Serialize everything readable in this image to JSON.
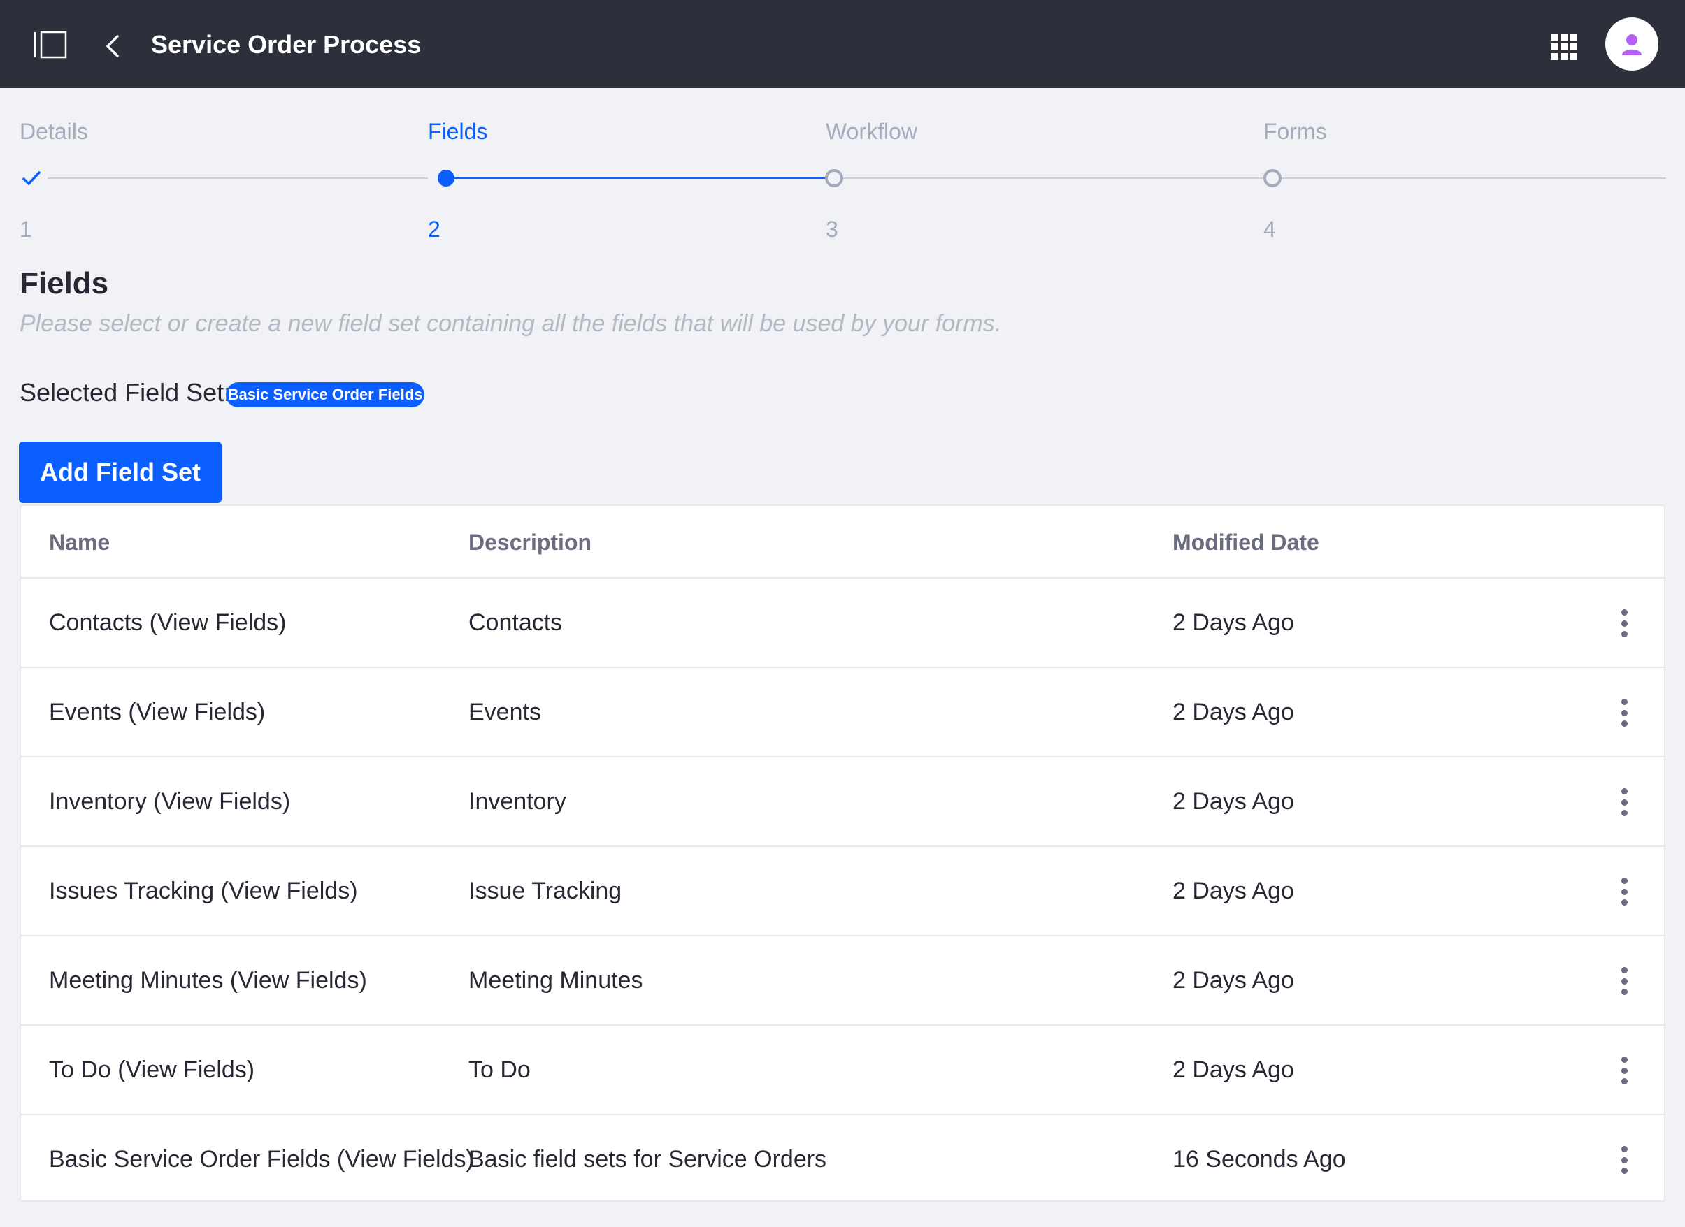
{
  "header": {
    "title": "Service Order Process"
  },
  "stepper": {
    "steps": [
      {
        "label": "Details",
        "number": "1",
        "state": "done"
      },
      {
        "label": "Fields",
        "number": "2",
        "state": "active"
      },
      {
        "label": "Workflow",
        "number": "3",
        "state": "pending"
      },
      {
        "label": "Forms",
        "number": "4",
        "state": "pending"
      }
    ]
  },
  "section": {
    "title": "Fields",
    "subtitle": "Please select or create a new field set containing all the fields that will be used by your forms.",
    "selected_label": "Selected Field Set:",
    "selected_value": "Basic Service Order Fields",
    "add_button": "Add Field Set"
  },
  "table": {
    "columns": [
      "Name",
      "Description",
      "Modified Date"
    ],
    "rows": [
      {
        "name": "Contacts (View Fields)",
        "description": "Contacts",
        "modified": "2 Days Ago"
      },
      {
        "name": "Events (View Fields)",
        "description": "Events",
        "modified": "2 Days Ago"
      },
      {
        "name": "Inventory (View Fields)",
        "description": "Inventory",
        "modified": "2 Days Ago"
      },
      {
        "name": "Issues Tracking (View Fields)",
        "description": "Issue Tracking",
        "modified": "2 Days Ago"
      },
      {
        "name": "Meeting Minutes (View Fields)",
        "description": "Meeting Minutes",
        "modified": "2 Days Ago"
      },
      {
        "name": "To Do (View Fields)",
        "description": "To Do",
        "modified": "2 Days Ago"
      },
      {
        "name": "Basic Service Order Fields (View Fields)",
        "description": "Basic field sets for Service Orders",
        "modified": "16 Seconds Ago"
      }
    ]
  },
  "colors": {
    "topbar": "#2d2f3b",
    "accent": "#0b5fff",
    "background": "#f1f2f5",
    "avatar_icon": "#b460f5"
  },
  "icons": {
    "sidebar_toggle": "sidebar-toggle-icon",
    "back": "chevron-left-icon",
    "apps": "apps-grid-icon",
    "avatar": "user-icon",
    "row_actions": "ellipsis-vertical-icon",
    "step_done": "check-icon"
  }
}
